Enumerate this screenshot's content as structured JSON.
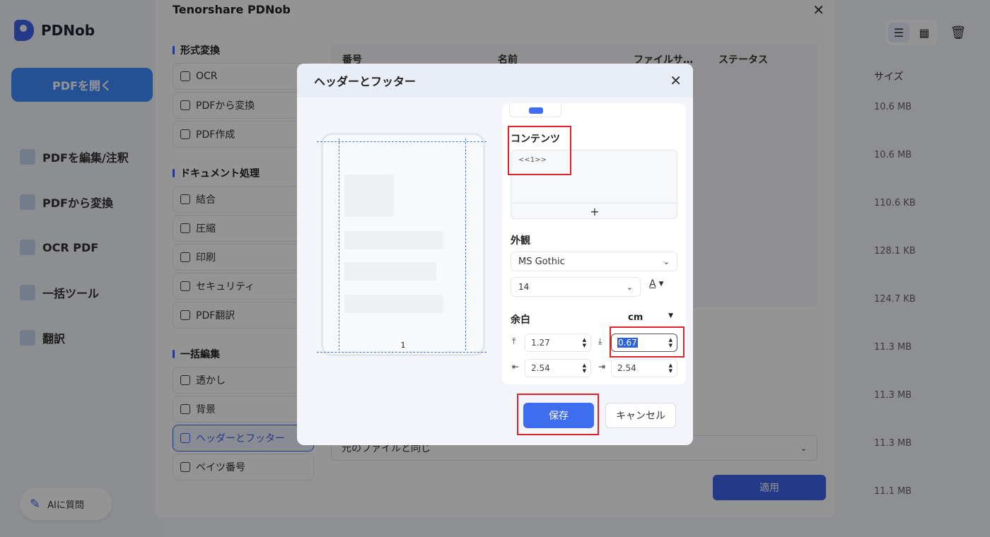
{
  "app": {
    "logo_text": "PDNob",
    "open_button": "PDFを開く",
    "nav": [
      {
        "label": "PDFを編集/注釈",
        "icon": "edit-icon"
      },
      {
        "label": "PDFから変換",
        "icon": "convert-icon"
      },
      {
        "label": "OCR PDF",
        "icon": "ocr-icon"
      },
      {
        "label": "一括ツール",
        "icon": "batch-icon"
      },
      {
        "label": "翻訳",
        "icon": "translate-icon"
      }
    ],
    "ai_button": "AIに質問",
    "size_header": "サイズ",
    "sizes": [
      "10.6 MB",
      "10.6 MB",
      "110.6 KB",
      "128.1 KB",
      "124.7 KB",
      "11.3 MB",
      "11.3 MB",
      "11.3 MB",
      "11.1 MB"
    ]
  },
  "tool_window": {
    "title": "Tenorshare PDNob",
    "groups": [
      {
        "title": "形式変換",
        "items": [
          "OCR",
          "PDFから変換",
          "PDF作成"
        ]
      },
      {
        "title": "ドキュメント処理",
        "items": [
          "結合",
          "圧縮",
          "印刷",
          "セキュリティ",
          "PDF翻訳"
        ]
      },
      {
        "title": "一括編集",
        "items": [
          "透かし",
          "背景",
          "ヘッダーとフッター",
          "ベイツ番号"
        ]
      }
    ],
    "active_item": "ヘッダーとフッター",
    "table_headers": [
      "番号",
      "名前",
      "ファイルサ…",
      "ステータス"
    ],
    "output_select": "元のファイルと同じ",
    "apply_button": "適用"
  },
  "dialog": {
    "title": "ヘッダーとフッター",
    "preview_page_number": "1",
    "contents_label": "コンテンツ",
    "contents_text": "<<1>>",
    "add_symbol": "+",
    "appearance_label": "外観",
    "font": "MS Gothic",
    "font_size": "14",
    "text_color_icon": "A",
    "margin_label": "余白",
    "unit": "cm",
    "margins": {
      "top": "1.27",
      "bottom": "0.67",
      "left": "2.54",
      "right": "2.54"
    },
    "save_button": "保存",
    "cancel_button": "キャンセル"
  },
  "colors": {
    "accent": "#3f6df0",
    "highlight": "#e0222a",
    "overlay": "rgba(0,0,0,0.42)"
  }
}
